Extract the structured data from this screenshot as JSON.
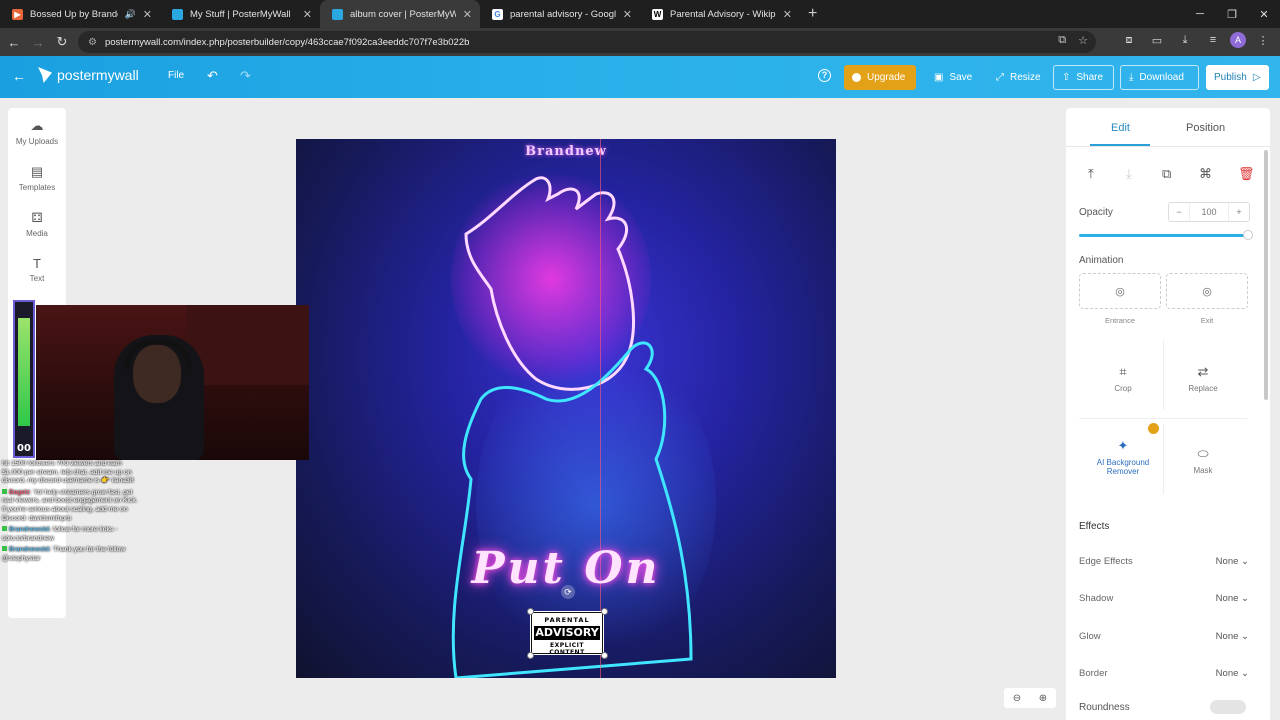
{
  "browser": {
    "tabs": [
      {
        "title": "Bossed Up by Brandon",
        "favicon_color": "#e8663a"
      },
      {
        "title": "My Stuff | PosterMyWall",
        "favicon_color": "#2aa8e0"
      },
      {
        "title": "album cover | PosterMyWall",
        "favicon_color": "#2aa8e0"
      },
      {
        "title": "parental advisory - Google Sea",
        "favicon_color": "#ffffff"
      },
      {
        "title": "Parental Advisory - Wikipedia",
        "favicon_color": "#ffffff"
      }
    ],
    "active_tab": 2,
    "url": "postermywall.com/index.php/posterbuilder/copy/463ccae7f092ca3eeddc707f7e3b022b",
    "profile_initial": "A"
  },
  "app": {
    "logo_text": "postermywall",
    "file_label": "File",
    "upgrade_label": "Upgrade",
    "save_label": "Save",
    "resize_label": "Resize",
    "share_label": "Share",
    "download_label": "Download",
    "publish_label": "Publish",
    "accent": "#2bb1ea",
    "upgrade_color": "#e3a117"
  },
  "left_panel": {
    "items": [
      {
        "label": "My Uploads",
        "icon": "upload-icon"
      },
      {
        "label": "Templates",
        "icon": "templates-icon"
      },
      {
        "label": "Media",
        "icon": "media-icon"
      },
      {
        "label": "Text",
        "icon": "text-icon"
      }
    ]
  },
  "canvas": {
    "top_text": "Brandnew",
    "title_text": "Put On",
    "advisory": {
      "line1": "PARENTAL",
      "line2": "ADVISORY",
      "line3": "EXPLICIT CONTENT"
    }
  },
  "stream": {
    "meter_value": "00",
    "chat": [
      {
        "user": "",
        "text": "hit 1500 followers 700 viewers and earn $1,000 per stream, lets chat, add me up on discord, my discord username is 👉 ilana38"
      },
      {
        "user": "Bagelz",
        "text": ": Yo! help streamers grow fast, get real viewers, and boost engagement on Kick. If you're serious about scaling, add me on Discord: davidsmithpro"
      },
      {
        "user": "Brandnewskii",
        "text": ": follow for more links - solo.to/brandnew"
      },
      {
        "user": "Brandnewskii",
        "text": ": Thank you for the follow @stephystar"
      }
    ]
  },
  "right_panel": {
    "tab_edit": "Edit",
    "tab_position": "Position",
    "opacity_label": "Opacity",
    "opacity_value": "100",
    "opacity_fraction": 1.0,
    "animation_label": "Animation",
    "entrance_label": "Entrance",
    "exit_label": "Exit",
    "crop_label": "Crop",
    "replace_label": "Replace",
    "ai_bg_label": "AI Background Remover",
    "mask_label": "Mask",
    "effects_label": "Effects",
    "effects": [
      {
        "name": "Edge Effects",
        "value": "None"
      },
      {
        "name": "Shadow",
        "value": "None"
      },
      {
        "name": "Glow",
        "value": "None"
      },
      {
        "name": "Border",
        "value": "None"
      }
    ],
    "roundness_label": "Roundness"
  }
}
